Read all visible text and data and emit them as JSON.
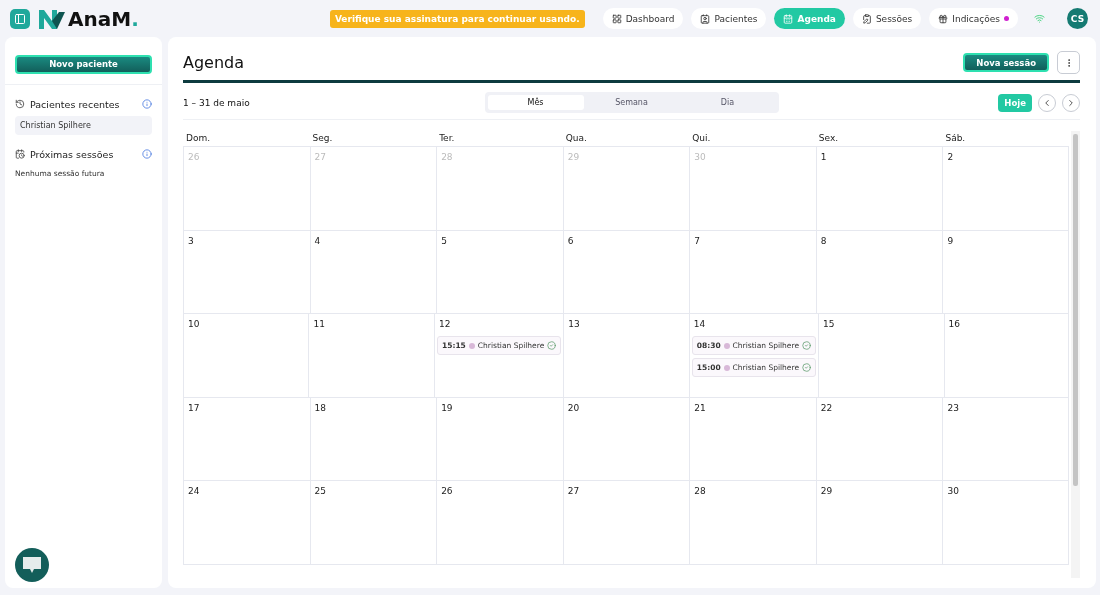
{
  "logo": {
    "text": "AnaM",
    "mark": "."
  },
  "banner": "Verifique sua assinatura para continuar usando.",
  "nav": [
    {
      "label": "Dashboard",
      "selected": false,
      "dot": false
    },
    {
      "label": "Pacientes",
      "selected": false,
      "dot": false
    },
    {
      "label": "Agenda",
      "selected": true,
      "dot": false
    },
    {
      "label": "Sessões",
      "selected": false,
      "dot": false
    },
    {
      "label": "Indicações",
      "selected": false,
      "dot": true
    }
  ],
  "avatar": "CS",
  "sidebar": {
    "new_button": "Novo paciente",
    "sections": [
      {
        "title": "Pacientes recentes",
        "items": [
          "Christian Spilhere"
        ]
      },
      {
        "title": "Próximas sessões",
        "empty": "Nenhuma sessão futura"
      }
    ]
  },
  "agenda": {
    "title": "Agenda",
    "new_button": "Nova sessão",
    "range": "1 – 31 de maio",
    "views": [
      {
        "label": "Mês",
        "selected": true
      },
      {
        "label": "Semana",
        "selected": false
      },
      {
        "label": "Dia",
        "selected": false
      }
    ],
    "today_button": "Hoje",
    "weekdays": [
      "Dom.",
      "Seg.",
      "Ter.",
      "Qua.",
      "Qui.",
      "Sex.",
      "Sáb."
    ],
    "weeks": [
      [
        {
          "day": "26",
          "muted": true
        },
        {
          "day": "27",
          "muted": true
        },
        {
          "day": "28",
          "muted": true
        },
        {
          "day": "29",
          "muted": true
        },
        {
          "day": "30",
          "muted": true
        },
        {
          "day": "1",
          "muted": false
        },
        {
          "day": "2",
          "muted": false
        }
      ],
      [
        {
          "day": "3",
          "muted": false
        },
        {
          "day": "4",
          "muted": false
        },
        {
          "day": "5",
          "muted": false
        },
        {
          "day": "6",
          "muted": false
        },
        {
          "day": "7",
          "muted": false
        },
        {
          "day": "8",
          "muted": false
        },
        {
          "day": "9",
          "muted": false
        }
      ],
      [
        {
          "day": "10",
          "muted": false
        },
        {
          "day": "11",
          "muted": false
        },
        {
          "day": "12",
          "muted": false,
          "events": [
            {
              "time": "15:15",
              "name": "Christian Spilhere",
              "color": "#d8b8d8"
            }
          ]
        },
        {
          "day": "13",
          "muted": false
        },
        {
          "day": "14",
          "muted": false,
          "events": [
            {
              "time": "08:30",
              "name": "Christian Spilhere",
              "color": "#d8b8d8"
            },
            {
              "time": "15:00",
              "name": "Christian Spilhere",
              "color": "#d8b8d8"
            }
          ]
        },
        {
          "day": "15",
          "muted": false
        },
        {
          "day": "16",
          "muted": false
        }
      ],
      [
        {
          "day": "17",
          "muted": false
        },
        {
          "day": "18",
          "muted": false
        },
        {
          "day": "19",
          "muted": false
        },
        {
          "day": "20",
          "muted": false
        },
        {
          "day": "21",
          "muted": false
        },
        {
          "day": "22",
          "muted": false
        },
        {
          "day": "23",
          "muted": false
        }
      ],
      [
        {
          "day": "24",
          "muted": false
        },
        {
          "day": "25",
          "muted": false
        },
        {
          "day": "26",
          "muted": false
        },
        {
          "day": "27",
          "muted": false
        },
        {
          "day": "28",
          "muted": false
        },
        {
          "day": "29",
          "muted": false
        },
        {
          "day": "30",
          "muted": false
        }
      ]
    ]
  }
}
